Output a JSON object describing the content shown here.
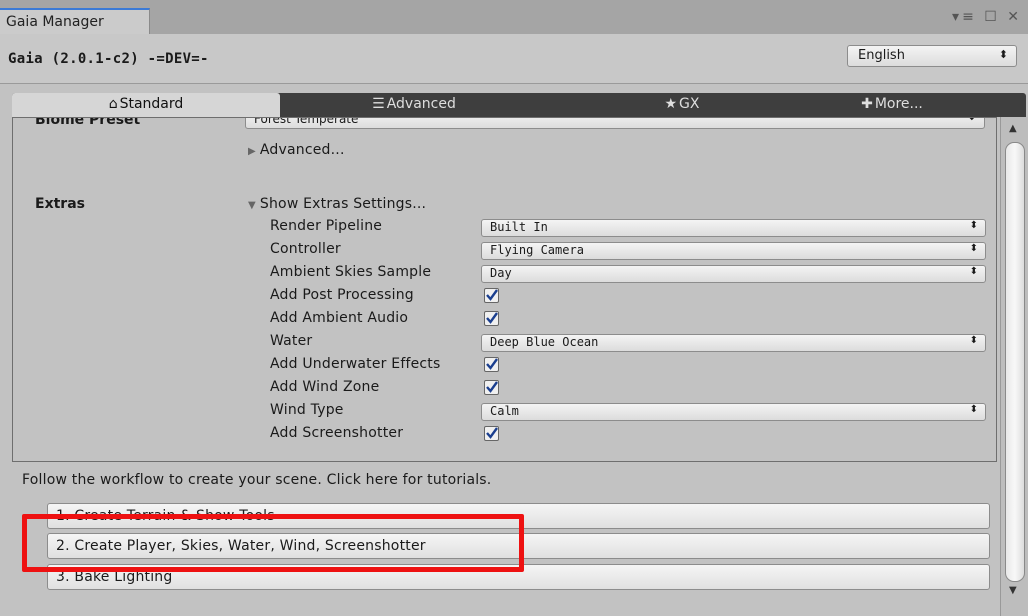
{
  "window": {
    "tab_title": "Gaia Manager",
    "controls": "▾≡ ☐ ✕"
  },
  "toolbar": {
    "app_title": "Gaia (2.0.1-c2) -=DEV=-",
    "language": "English"
  },
  "tabs": [
    {
      "label": "Standard",
      "icon": "home-icon",
      "active": true
    },
    {
      "label": "Advanced",
      "icon": "list-icon",
      "active": false
    },
    {
      "label": "GX",
      "icon": "star-icon",
      "active": false
    },
    {
      "label": "More...",
      "icon": "plus-icon",
      "active": false
    }
  ],
  "biome": {
    "label": "Biome Preset",
    "value": "Forest Temperate",
    "advanced_label": "Advanced..."
  },
  "extras": {
    "label": "Extras",
    "foldout_label": "Show Extras Settings...",
    "render_pipeline": {
      "label": "Render Pipeline",
      "value": "Built In"
    },
    "controller": {
      "label": "Controller",
      "value": "Flying Camera"
    },
    "ambient_skies": {
      "label": "Ambient Skies Sample",
      "value": "Day"
    },
    "post_processing": {
      "label": "Add Post Processing",
      "checked": true
    },
    "ambient_audio": {
      "label": "Add Ambient Audio",
      "checked": true
    },
    "water": {
      "label": "Water",
      "value": "Deep Blue Ocean"
    },
    "underwater": {
      "label": "Add Underwater Effects",
      "checked": true
    },
    "wind_zone": {
      "label": "Add Wind Zone",
      "checked": true
    },
    "wind_type": {
      "label": "Wind Type",
      "value": "Calm"
    },
    "screenshotter": {
      "label": "Add Screenshotter",
      "checked": true
    }
  },
  "workflow": {
    "note": "Follow the workflow to create your scene. Click here for tutorials.",
    "steps": [
      "1. Create Terrain & Show Tools",
      "2. Create Player, Skies, Water, Wind, Screenshotter",
      "3. Bake Lighting"
    ]
  },
  "colors": {
    "highlight": "#ee1111",
    "checkmark": "#1b3f8f"
  }
}
